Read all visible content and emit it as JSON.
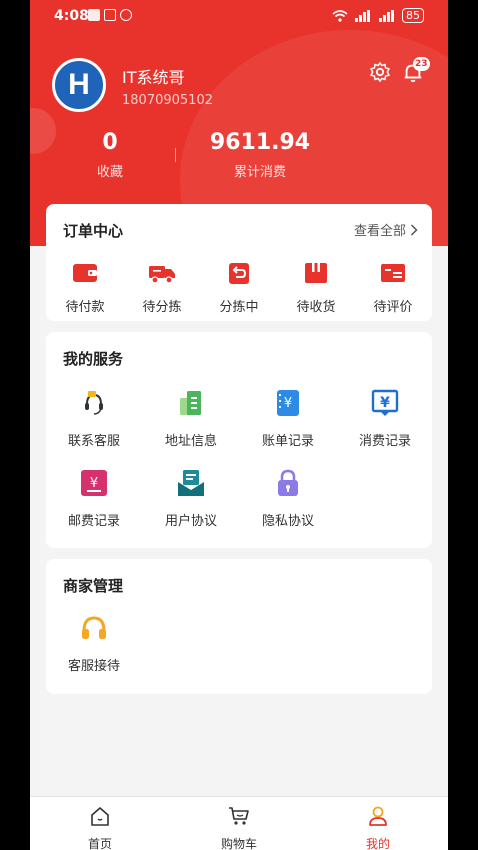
{
  "status_bar": {
    "time": "4:08",
    "battery": "85"
  },
  "user": {
    "name": "IT系统哥",
    "phone": "18070905102",
    "avatar_letter": "H",
    "notification_count": "23"
  },
  "stats": [
    {
      "value": "0",
      "label": "收藏"
    },
    {
      "value": "9611.94",
      "label": "累计消费"
    }
  ],
  "orders": {
    "title": "订单中心",
    "view_all": "查看全部",
    "items": [
      {
        "label": "待付款",
        "icon": "wallet-icon"
      },
      {
        "label": "待分拣",
        "icon": "truck-icon"
      },
      {
        "label": "分拣中",
        "icon": "box-return-icon"
      },
      {
        "label": "待收货",
        "icon": "package-icon"
      },
      {
        "label": "待评价",
        "icon": "review-icon"
      }
    ]
  },
  "services": {
    "title": "我的服务",
    "items": [
      {
        "label": "联系客服",
        "icon": "headset-icon"
      },
      {
        "label": "地址信息",
        "icon": "address-icon"
      },
      {
        "label": "账单记录",
        "icon": "bill-icon"
      },
      {
        "label": "消费记录",
        "icon": "receipt-icon"
      },
      {
        "label": "邮费记录",
        "icon": "postage-icon"
      },
      {
        "label": "用户协议",
        "icon": "agreement-icon"
      },
      {
        "label": "隐私协议",
        "icon": "lock-icon"
      }
    ]
  },
  "merchant": {
    "title": "商家管理",
    "items": [
      {
        "label": "客服接待",
        "icon": "headphones-icon"
      }
    ]
  },
  "tabbar": [
    {
      "label": "首页",
      "icon": "home-icon"
    },
    {
      "label": "购物车",
      "icon": "cart-icon"
    },
    {
      "label": "我的",
      "icon": "profile-icon",
      "active": true
    }
  ],
  "colors": {
    "primary": "#e8332c",
    "background": "#f4f4f4"
  }
}
